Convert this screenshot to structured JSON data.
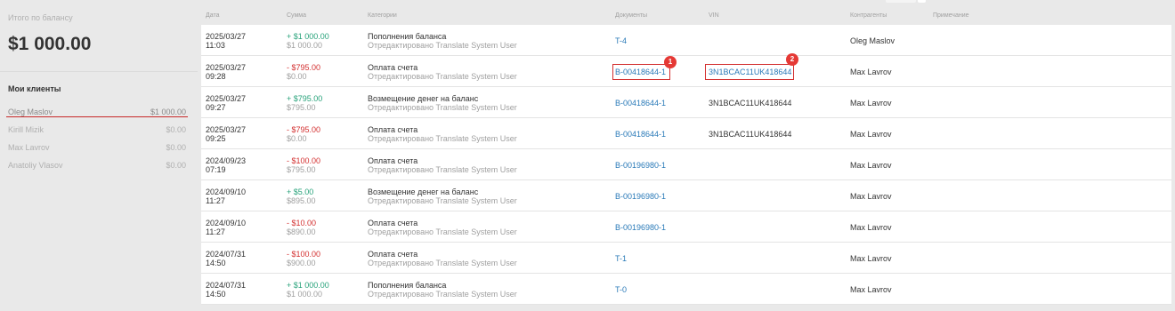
{
  "sidebar": {
    "balance_label": "Итого по балансу",
    "balance_value": "$1 000.00",
    "clients_title": "Мои клиенты",
    "clients": [
      {
        "name": "Oleg Maslov",
        "amount": "$1 000.00",
        "active": true
      },
      {
        "name": "Kirill Mizik",
        "amount": "$0.00",
        "active": false
      },
      {
        "name": "Max Lavrov",
        "amount": "$0.00",
        "active": false
      },
      {
        "name": "Anatoliy Vlasov",
        "amount": "$0.00",
        "active": false
      }
    ]
  },
  "table": {
    "headers": {
      "date": "Дата",
      "sum": "Сумма",
      "category": "Категории",
      "documents": "Документы",
      "vin": "VIN",
      "agents": "Контрагенты",
      "note": "Примечание"
    },
    "rows": [
      {
        "date": "2025/03/27",
        "time": "11:03",
        "amount": "+ $1 000.00",
        "amount_type": "pos",
        "balance": "$1 000.00",
        "category": "Пополнения баланса",
        "edited": "Отредактировано Translate System User",
        "doc": "T-4",
        "vin": "",
        "agent": "Oleg Maslov"
      },
      {
        "date": "2025/03/27",
        "time": "09:28",
        "amount": "- $795.00",
        "amount_type": "neg",
        "balance": "$0.00",
        "category": "Оплата счета",
        "edited": "Отредактировано Translate System User",
        "doc": "B-00418644-1",
        "vin": "3N1BCAC11UK418644",
        "agent": "Max Lavrov"
      },
      {
        "date": "2025/03/27",
        "time": "09:27",
        "amount": "+ $795.00",
        "amount_type": "pos",
        "balance": "$795.00",
        "category": "Возмещение денег на баланс",
        "edited": "Отредактировано Translate System User",
        "doc": "B-00418644-1",
        "vin": "3N1BCAC11UK418644",
        "agent": "Max Lavrov"
      },
      {
        "date": "2025/03/27",
        "time": "09:25",
        "amount": "- $795.00",
        "amount_type": "neg",
        "balance": "$0.00",
        "category": "Оплата счета",
        "edited": "Отредактировано Translate System User",
        "doc": "B-00418644-1",
        "vin": "3N1BCAC11UK418644",
        "agent": "Max Lavrov"
      },
      {
        "date": "2024/09/23",
        "time": "07:19",
        "amount": "- $100.00",
        "amount_type": "neg",
        "balance": "$795.00",
        "category": "Оплата счета",
        "edited": "Отредактировано Translate System User",
        "doc": "B-00196980-1",
        "vin": "",
        "agent": "Max Lavrov"
      },
      {
        "date": "2024/09/10",
        "time": "11:27",
        "amount": "+ $5.00",
        "amount_type": "pos",
        "balance": "$895.00",
        "category": "Возмещение денег на баланс",
        "edited": "Отредактировано Translate System User",
        "doc": "B-00196980-1",
        "vin": "",
        "agent": "Max Lavrov"
      },
      {
        "date": "2024/09/10",
        "time": "11:27",
        "amount": "- $10.00",
        "amount_type": "neg",
        "balance": "$890.00",
        "category": "Оплата счета",
        "edited": "Отредактировано Translate System User",
        "doc": "B-00196980-1",
        "vin": "",
        "agent": "Max Lavrov"
      },
      {
        "date": "2024/07/31",
        "time": "14:50",
        "amount": "- $100.00",
        "amount_type": "neg",
        "balance": "$900.00",
        "category": "Оплата счета",
        "edited": "Отредактировано Translate System User",
        "doc": "T-1",
        "vin": "",
        "agent": "Max Lavrov"
      },
      {
        "date": "2024/07/31",
        "time": "14:50",
        "amount": "+ $1 000.00",
        "amount_type": "pos",
        "balance": "$1 000.00",
        "category": "Пополнения баланса",
        "edited": "Отредактировано Translate System User",
        "doc": "T-0",
        "vin": "",
        "agent": "Max Lavrov"
      }
    ]
  },
  "annotations": [
    {
      "label": "1",
      "target": "B-00418644-1"
    },
    {
      "label": "2",
      "target": "3N1BCAC11UK418644"
    }
  ]
}
